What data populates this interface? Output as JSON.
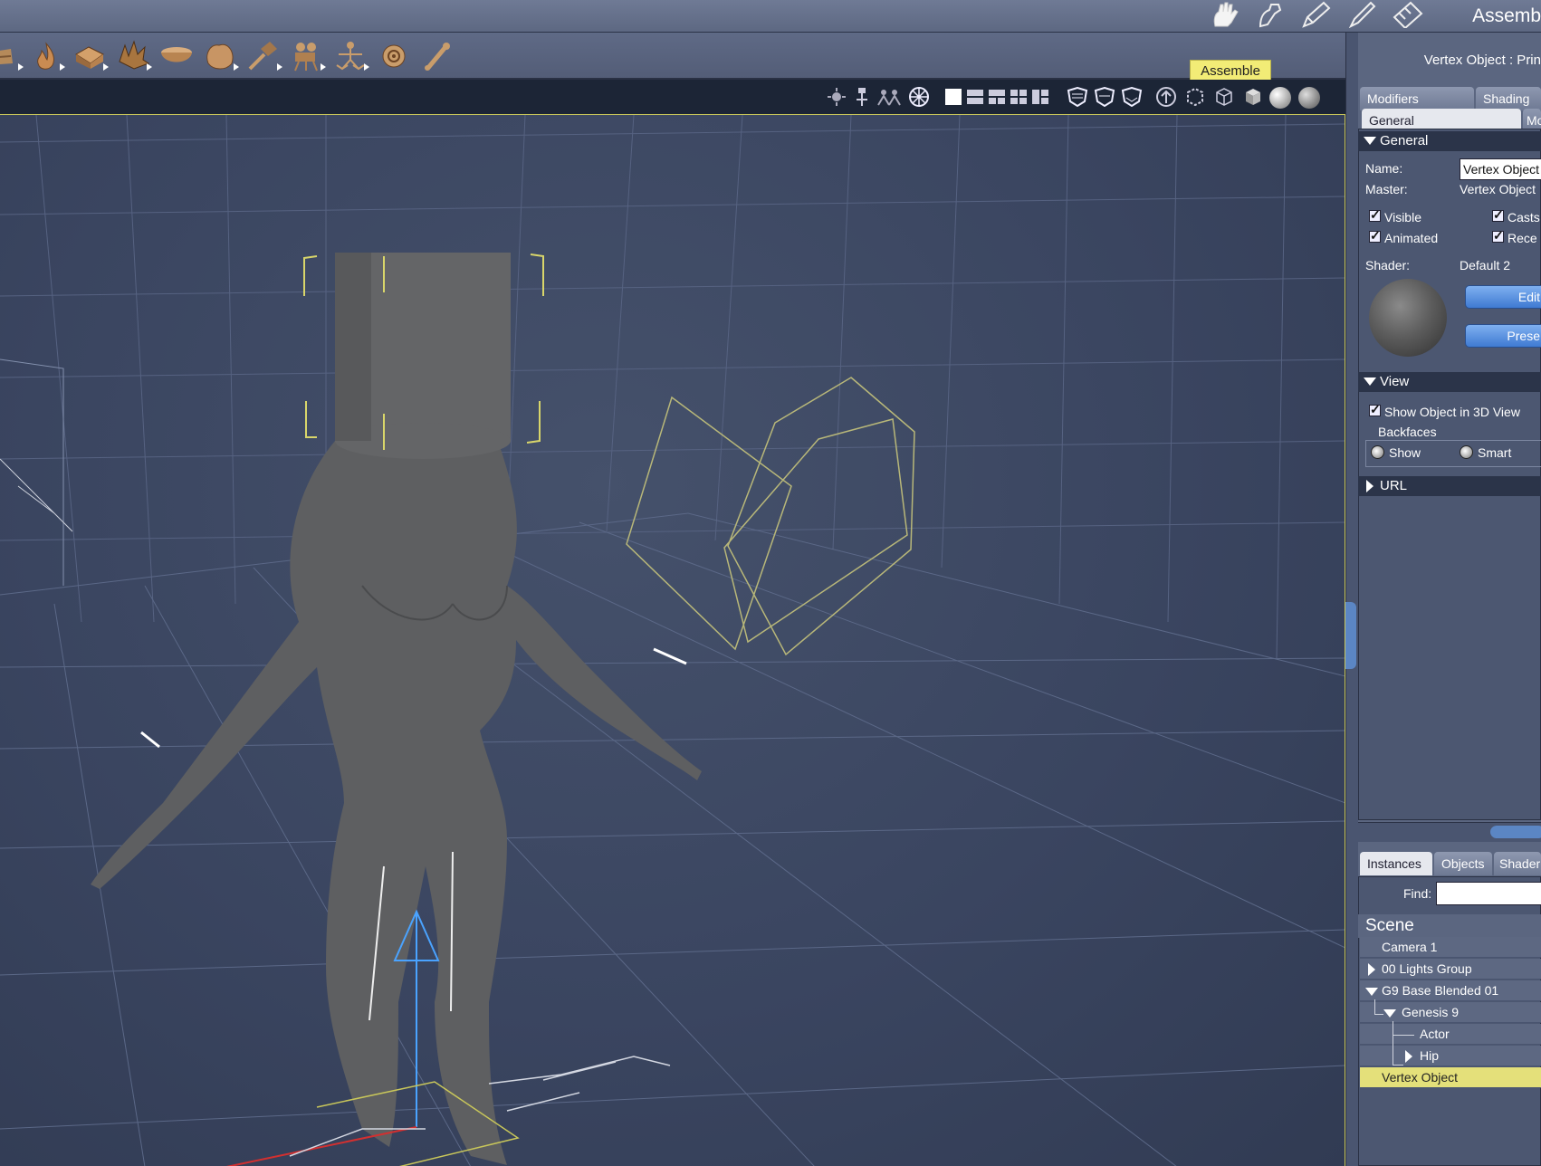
{
  "top_bar": {
    "room_title": "Assemb",
    "room_icons": [
      "hand-icon",
      "pose-icon",
      "pen-icon",
      "brush-icon",
      "film-icon"
    ]
  },
  "tooltip": {
    "text": "Assemble"
  },
  "toolbar": {
    "tools": [
      "partial-tool-icon",
      "flame-icon",
      "box-primitive-icon",
      "explosion-icon",
      "bowl-icon",
      "rock-icon",
      "hammer-icon",
      "camera-rig-icon",
      "figure-icon",
      "target-icon",
      "bone-icon"
    ]
  },
  "view_controls": {
    "items": [
      "light-toggle-icon",
      "tripod-icon",
      "figures-icon",
      "grid-toggle-icon",
      "layout-single-icon",
      "layout-two-icon",
      "layout-three-icon",
      "layout-four-icon",
      "layout-custom-icon",
      "shield-1-icon",
      "shield-2-icon",
      "shield-3-icon",
      "arrow-up-icon",
      "bbox-icon",
      "wire-cube-icon",
      "solid-cube-icon",
      "smooth-sphere-icon",
      "texture-sphere-icon"
    ]
  },
  "panel": {
    "title": "Vertex Object : Prin",
    "tabs": {
      "modifiers": "Modifiers",
      "shading": "Shading",
      "general": "General",
      "more": "Mo"
    },
    "general_section": {
      "heading": "General",
      "name_label": "Name:",
      "name_value": "Vertex Object",
      "master_label": "Master:",
      "master_value": "Vertex Object",
      "visible": "Visible",
      "animated": "Animated",
      "casts": "Casts",
      "receives": "Rece",
      "shader_label": "Shader:",
      "shader_value": "Default 2",
      "edit_button": "Edit",
      "presets_button": "Prese"
    },
    "view_section": {
      "heading": "View",
      "show_in_3d": "Show Object in 3D View",
      "backfaces": "Backfaces",
      "show": "Show",
      "smart": "Smart"
    },
    "url_section": {
      "heading": "URL"
    }
  },
  "scene_panel": {
    "tabs": {
      "instances": "Instances",
      "objects": "Objects",
      "shaders": "Shader"
    },
    "find_label": "Find:",
    "find_value": "",
    "heading": "Scene",
    "items": [
      "Camera 1",
      "00 Lights Group",
      "G9 Base Blended 01",
      "Genesis 9",
      "Actor",
      "Hip",
      "Vertex Object"
    ]
  },
  "colors": {
    "viewport_bg": "#3a4560",
    "selection": "#c9c75a",
    "tooltip": "#f2ec76",
    "selected_row": "#e4e07a",
    "button_blue": "#3f7ad2"
  }
}
